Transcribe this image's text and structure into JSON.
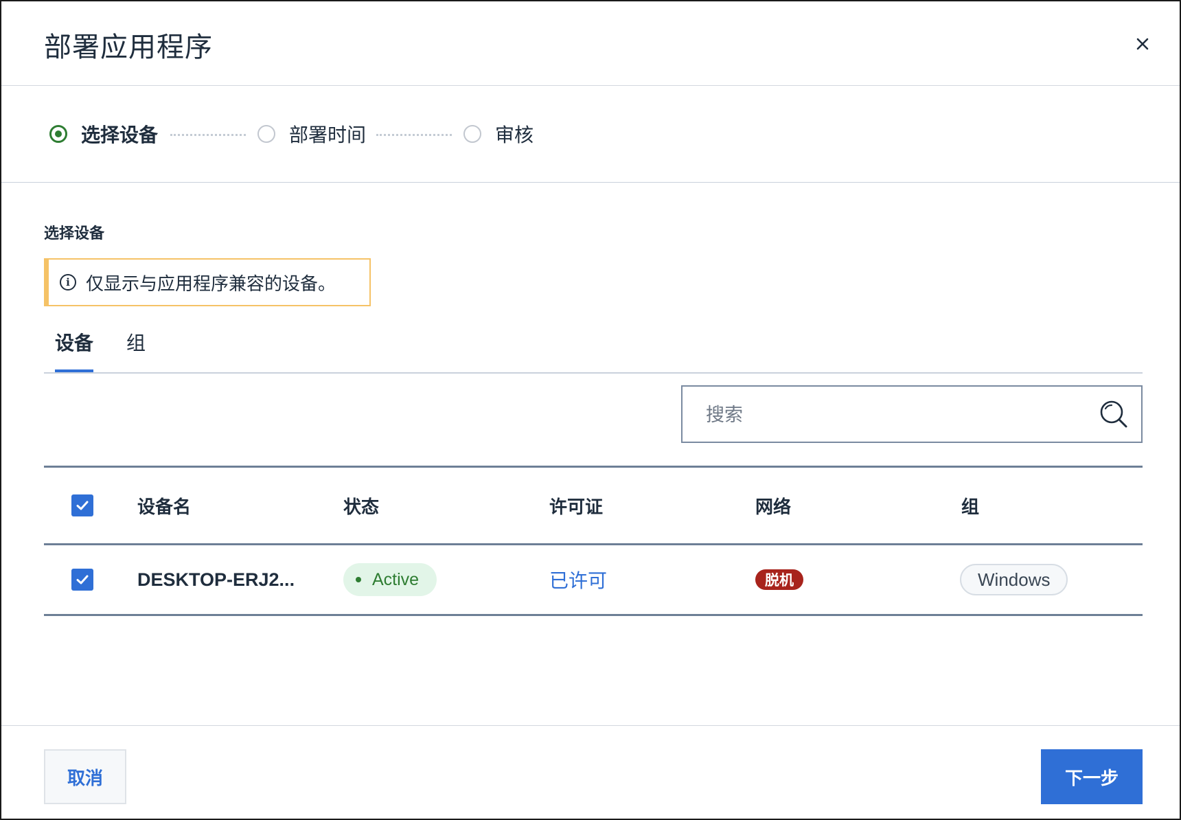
{
  "dialog": {
    "title": "部署应用程序"
  },
  "stepper": {
    "steps": [
      {
        "label": "选择设备",
        "state": "active"
      },
      {
        "label": "部署时间",
        "state": "inactive"
      },
      {
        "label": "审核",
        "state": "inactive"
      }
    ]
  },
  "section": {
    "title": "选择设备"
  },
  "info": {
    "text": "仅显示与应用程序兼容的设备。",
    "icon": "info-icon"
  },
  "tabs": [
    {
      "label": "设备",
      "active": true
    },
    {
      "label": "组",
      "active": false
    }
  ],
  "search": {
    "placeholder": "搜索",
    "value": ""
  },
  "table": {
    "columns": [
      "设备名",
      "状态",
      "许可证",
      "网络",
      "组"
    ],
    "header_checked": true,
    "rows": [
      {
        "checked": true,
        "device_name": "DESKTOP-ERJ2...",
        "status": "Active",
        "license": "已许可",
        "network": "脱机",
        "group": "Windows"
      }
    ]
  },
  "footer": {
    "cancel_label": "取消",
    "next_label": "下一步"
  },
  "colors": {
    "primary": "#2f6fd6",
    "step_active": "#2e7d32",
    "status_active_bg": "#e2f5e8",
    "status_active_text": "#2e7d32",
    "offline_badge": "#a8231c",
    "info_border": "#f5c266"
  }
}
